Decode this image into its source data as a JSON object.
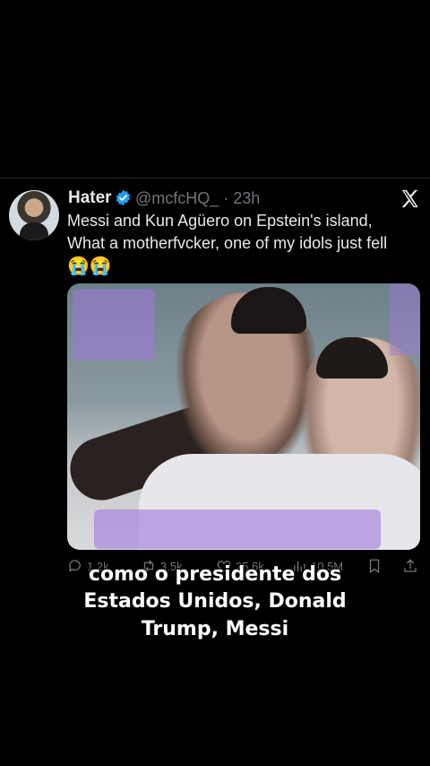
{
  "tweet": {
    "name": "Hater",
    "handle": "@mcfcHQ_ · 23h",
    "text_line1": "Messi and Kun Agüero on Epstein's island,",
    "text_line2": "What a motherfvcker, one of my idols just fell",
    "emojis": "😭😭",
    "verified_color": "#1d9bf0",
    "actions": {
      "reply": "1.2k",
      "retweet": "3.5k",
      "like": "25.6k",
      "views": "10.5M"
    }
  },
  "caption": {
    "line1": "como o presidente dos",
    "line2": "Estados Unidos, Donald",
    "line3": "Trump, Messi"
  }
}
